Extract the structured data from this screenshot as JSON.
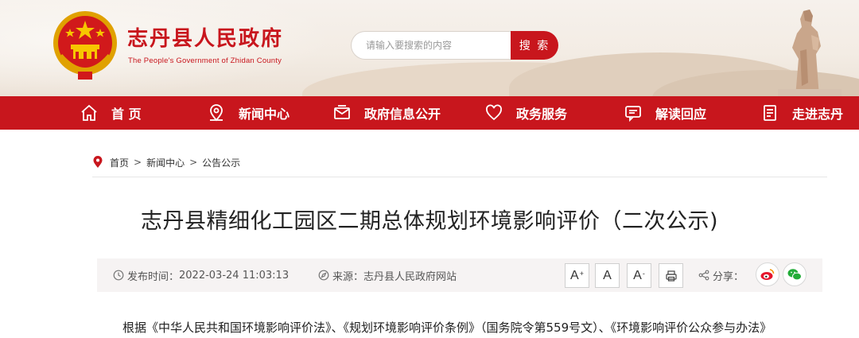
{
  "header": {
    "title": "志丹县人民政府",
    "subtitle": "The People's Government of Zhidan County",
    "search_placeholder": "请输入要搜索的内容",
    "search_button": "搜 索"
  },
  "nav": {
    "items": [
      {
        "label": "首 页",
        "icon": "home-icon"
      },
      {
        "label": "新闻中心",
        "icon": "location-icon"
      },
      {
        "label": "政府信息公开",
        "icon": "mail-icon"
      },
      {
        "label": "政务服务",
        "icon": "heart-icon"
      },
      {
        "label": "解读回应",
        "icon": "chat-icon"
      },
      {
        "label": "走进志丹",
        "icon": "document-icon"
      }
    ]
  },
  "breadcrumb": {
    "items": [
      "首页",
      "新闻中心",
      "公告公示"
    ],
    "separator": ">"
  },
  "article": {
    "title": "志丹县精细化工园区二期总体规划环境影响评价（二次公示)",
    "publish_label": "发布时间：",
    "publish_time": "2022-03-24 11:03:13",
    "source_label": "来源：",
    "source": "志丹县人民政府网站",
    "font_buttons": [
      "A",
      "A",
      "A"
    ],
    "share_label": "分享：",
    "first_line": "根据《中华人民共和国环境影响评价法》、《规划环境影响评价条例》（国务院令第559号文）、《环境影响评价公众参与办法》"
  },
  "colors": {
    "brand_red": "#c8161d",
    "meta_bg": "#f6f3f3"
  }
}
